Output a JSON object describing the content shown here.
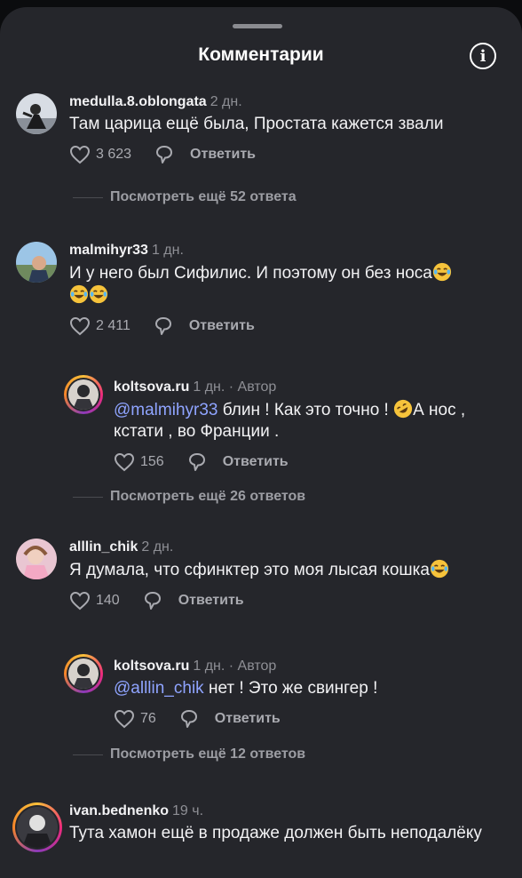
{
  "header": {
    "title": "Комментарии",
    "info_icon": "info-icon"
  },
  "comments": [
    {
      "username": "medulla.8.oblongata",
      "time": "2 дн.",
      "text": "Там царица ещё была, Простата кажется звали",
      "likes": "3 623",
      "reply": "Ответить",
      "more": "Посмотреть ещё 52 ответа"
    },
    {
      "username": "malmihyr33",
      "time": "1 дн.",
      "text": "И у него был Сифилис. И поэтому он без носа",
      "likes": "2 411",
      "reply": "Ответить"
    },
    {
      "username": "koltsova.ru",
      "time": "1 дн. · Автор",
      "mention": "@malmihyr33",
      "text": " блин ! Как это точно ! ",
      "text2": "А нос , кстати , во Франции .",
      "likes": "156",
      "reply": "Ответить",
      "more": "Посмотреть ещё 26 ответов"
    },
    {
      "username": "alllin_chik",
      "time": "2 дн.",
      "text": "Я думала, что сфинктер это моя лысая кошка",
      "likes": "140",
      "reply": "Ответить"
    },
    {
      "username": "koltsova.ru",
      "time": "1 дн. · Автор",
      "mention": "@alllin_chik",
      "text": " нет ! Это же свингер !",
      "likes": "76",
      "reply": "Ответить",
      "more": "Посмотреть ещё 12 ответов"
    },
    {
      "username": "ivan.bednenko",
      "time": "19 ч.",
      "text": "Тута хамон ещё в продаже должен быть неподалёку"
    }
  ]
}
